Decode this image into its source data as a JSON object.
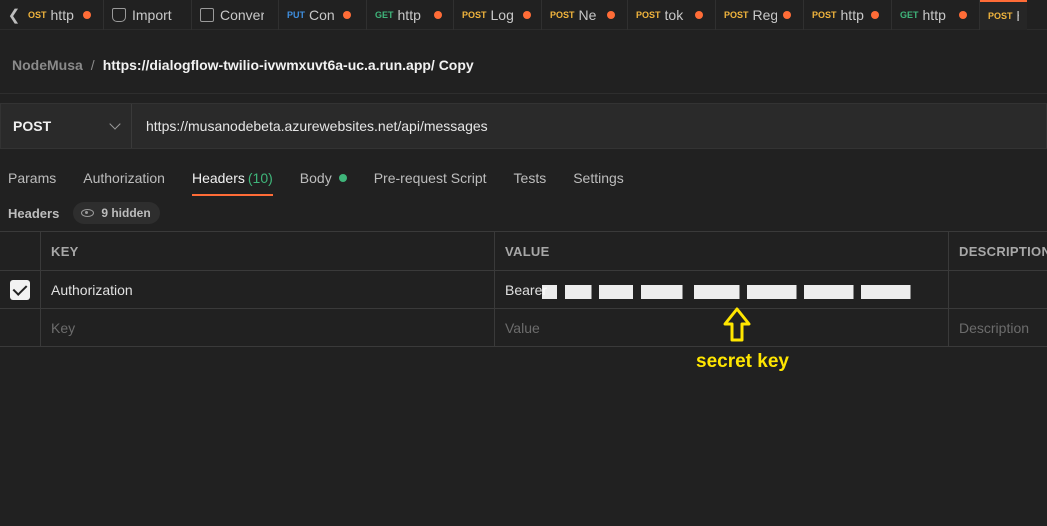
{
  "tabs": [
    {
      "method": "POST",
      "name": "http",
      "method_class": "m-post"
    },
    {
      "method": "",
      "name": "Import",
      "icon": "import-icon"
    },
    {
      "method": "",
      "name": "Conver",
      "icon": "document-icon"
    },
    {
      "method": "PUT",
      "name": "Con",
      "method_class": "m-put"
    },
    {
      "method": "GET",
      "name": "http",
      "method_class": "m-get"
    },
    {
      "method": "POST",
      "name": "Log",
      "method_class": "m-post"
    },
    {
      "method": "POST",
      "name": "Ne",
      "method_class": "m-post"
    },
    {
      "method": "POST",
      "name": "tok",
      "method_class": "m-post"
    },
    {
      "method": "POST",
      "name": "Reg",
      "method_class": "m-post"
    },
    {
      "method": "POST",
      "name": "http",
      "method_class": "m-post"
    },
    {
      "method": "GET",
      "name": "http",
      "method_class": "m-get"
    },
    {
      "method": "POST",
      "name": "h",
      "method_class": "m-post"
    }
  ],
  "breadcrumb": {
    "workspace": "NodeMusa",
    "separator": "/",
    "request_name": "https://dialogflow-twilio-ivwmxuvt6a-uc.a.run.app/ Copy"
  },
  "request": {
    "method": "POST",
    "url": "https://musanodebeta.azurewebsites.net/api/messages"
  },
  "subtabs": {
    "params": "Params",
    "authorization": "Authorization",
    "headers": "Headers",
    "headers_count": "(10)",
    "body": "Body",
    "prerequest": "Pre-request Script",
    "tests": "Tests",
    "settings": "Settings"
  },
  "headers_section": {
    "label": "Headers",
    "hidden": "9 hidden"
  },
  "table": {
    "columns": {
      "key": "KEY",
      "value": "VALUE",
      "description": "DESCRIPTION"
    },
    "rows": [
      {
        "key": "Authorization",
        "value_prefix": "Bearer",
        "checked": true
      }
    ],
    "placeholders": {
      "key": "Key",
      "value": "Value",
      "description": "Description"
    }
  },
  "annotation": {
    "text": "secret key",
    "color": "#ffe600"
  },
  "colors": {
    "accent": "#ff6c37",
    "get": "#3fb57a",
    "post": "#f2b53d",
    "put": "#3f8fe0"
  }
}
